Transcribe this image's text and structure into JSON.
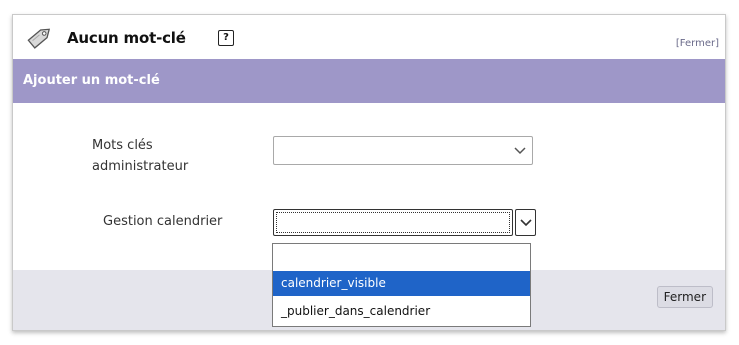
{
  "panel": {
    "title": "Aucun mot-clé",
    "help": "?",
    "close_link": "[Fermer]"
  },
  "form": {
    "header": "Ajouter un mot-clé",
    "fields": [
      {
        "label": "Mots clés administrateur",
        "value": ""
      },
      {
        "label": "Gestion calendrier",
        "value": ""
      }
    ]
  },
  "dropdown": {
    "options": [
      "",
      "calendrier_visible",
      "_publier_dans_calendrier"
    ],
    "highlighted": "calendrier_visible"
  },
  "footer": {
    "close_button": "Fermer"
  },
  "colors": {
    "header_bar": "#9e97c8",
    "highlight": "#1f64c8",
    "footer_bg": "#e5e5ec"
  },
  "icons": [
    "tag-icon",
    "help-icon",
    "chevron-down-icon"
  ]
}
